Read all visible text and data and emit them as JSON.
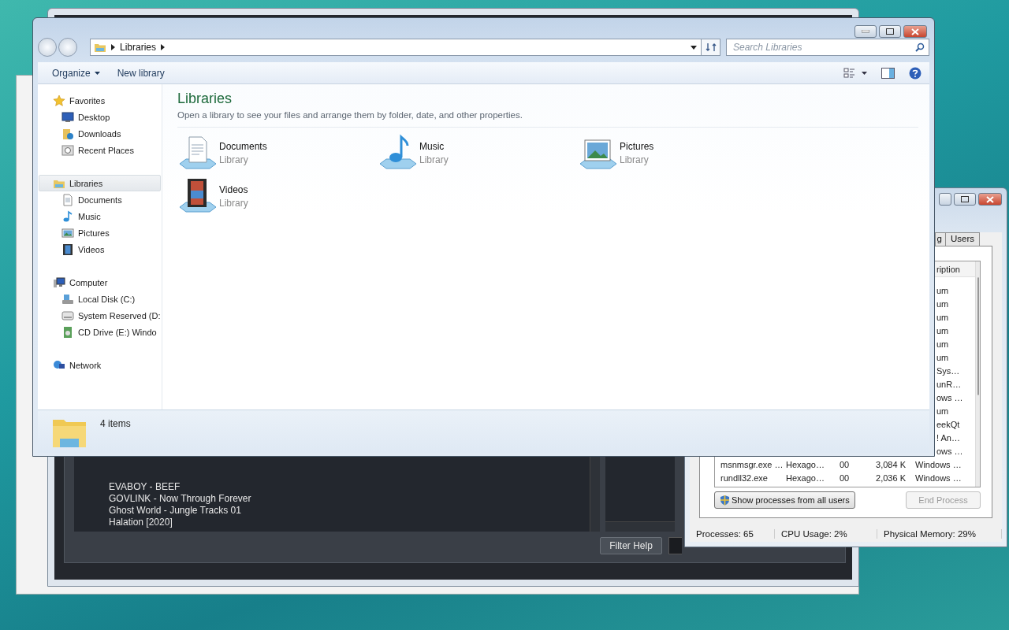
{
  "background_window": {
    "tracks": [
      "EVABOY - BEEF",
      "GOVLINK - Now Through Forever",
      "Ghost World - Jungle Tracks 01",
      "Halation [2020]"
    ],
    "filter_button": "Filter Help"
  },
  "task_manager": {
    "tabs": [
      {
        "label": "g",
        "selected": false
      },
      {
        "label": "Users",
        "selected": false
      }
    ],
    "column_header": "ription",
    "rows": [
      {
        "kind": "partial",
        "description": "um"
      },
      {
        "kind": "partial",
        "description": "um"
      },
      {
        "kind": "partial",
        "description": "um"
      },
      {
        "kind": "partial",
        "description": "um"
      },
      {
        "kind": "partial",
        "description": "um"
      },
      {
        "kind": "partial",
        "description": "um"
      },
      {
        "kind": "partial",
        "description": "Sys…"
      },
      {
        "kind": "partial",
        "description": "unR…"
      },
      {
        "kind": "partial",
        "description": "ows …"
      },
      {
        "kind": "partial",
        "description": "um"
      },
      {
        "kind": "partial",
        "description": "eekQt"
      },
      {
        "kind": "partial",
        "description": "! An…"
      },
      {
        "kind": "partial",
        "description": "ows …"
      },
      {
        "kind": "full",
        "image": "msnmsgr.exe …",
        "user": "Hexago…",
        "cpu": "00",
        "memory": "3,084 K",
        "description": "Windows …"
      },
      {
        "kind": "full",
        "image": "rundll32.exe",
        "user": "Hexago…",
        "cpu": "00",
        "memory": "2,036 K",
        "description": "Windows …"
      }
    ],
    "buttons": [
      {
        "label": "Show processes from all users",
        "disabled": false,
        "shield": true
      },
      {
        "label": "End Process",
        "disabled": true,
        "shield": false
      }
    ],
    "status_bar": [
      "Processes: 65",
      "CPU Usage: 2%",
      "Physical Memory: 29%"
    ]
  },
  "explorer": {
    "breadcrumb": "Libraries",
    "search": {
      "placeholder": "Search Libraries"
    },
    "toolbar": [
      {
        "label": "Organize",
        "menu": true
      },
      {
        "label": "New library",
        "menu": false
      }
    ],
    "nav": [
      {
        "label": "Favorites",
        "kind": "star",
        "selected": false,
        "children": [
          {
            "label": "Desktop",
            "kind": "desktop",
            "selected": false
          },
          {
            "label": "Downloads",
            "kind": "downloads",
            "selected": false
          },
          {
            "label": "Recent Places",
            "kind": "recent",
            "selected": false
          }
        ]
      },
      {
        "label": "Libraries",
        "kind": "library",
        "selected": true,
        "children": [
          {
            "label": "Documents",
            "kind": "document",
            "selected": false
          },
          {
            "label": "Music",
            "kind": "music",
            "selected": false
          },
          {
            "label": "Pictures",
            "kind": "picture",
            "selected": false
          },
          {
            "label": "Videos",
            "kind": "video",
            "selected": false
          }
        ]
      },
      {
        "label": "Computer",
        "kind": "computer",
        "selected": false,
        "children": [
          {
            "label": "Local Disk (C:)",
            "kind": "disk",
            "selected": false
          },
          {
            "label": "System Reserved (D:",
            "kind": "drive",
            "selected": false
          },
          {
            "label": "CD Drive (E:) Windo",
            "kind": "cd",
            "selected": false
          }
        ]
      },
      {
        "label": "Network",
        "kind": "network",
        "selected": false
      }
    ],
    "heading": "Libraries",
    "subtitle": "Open a library to see your files and arrange them by folder, date, and other properties.",
    "libraries": [
      {
        "name": "Documents",
        "type": "Library",
        "kind": "document"
      },
      {
        "name": "Music",
        "type": "Library",
        "kind": "music"
      },
      {
        "name": "Pictures",
        "type": "Library",
        "kind": "picture"
      },
      {
        "name": "Videos",
        "type": "Library",
        "kind": "video"
      }
    ],
    "status": "4 items"
  }
}
